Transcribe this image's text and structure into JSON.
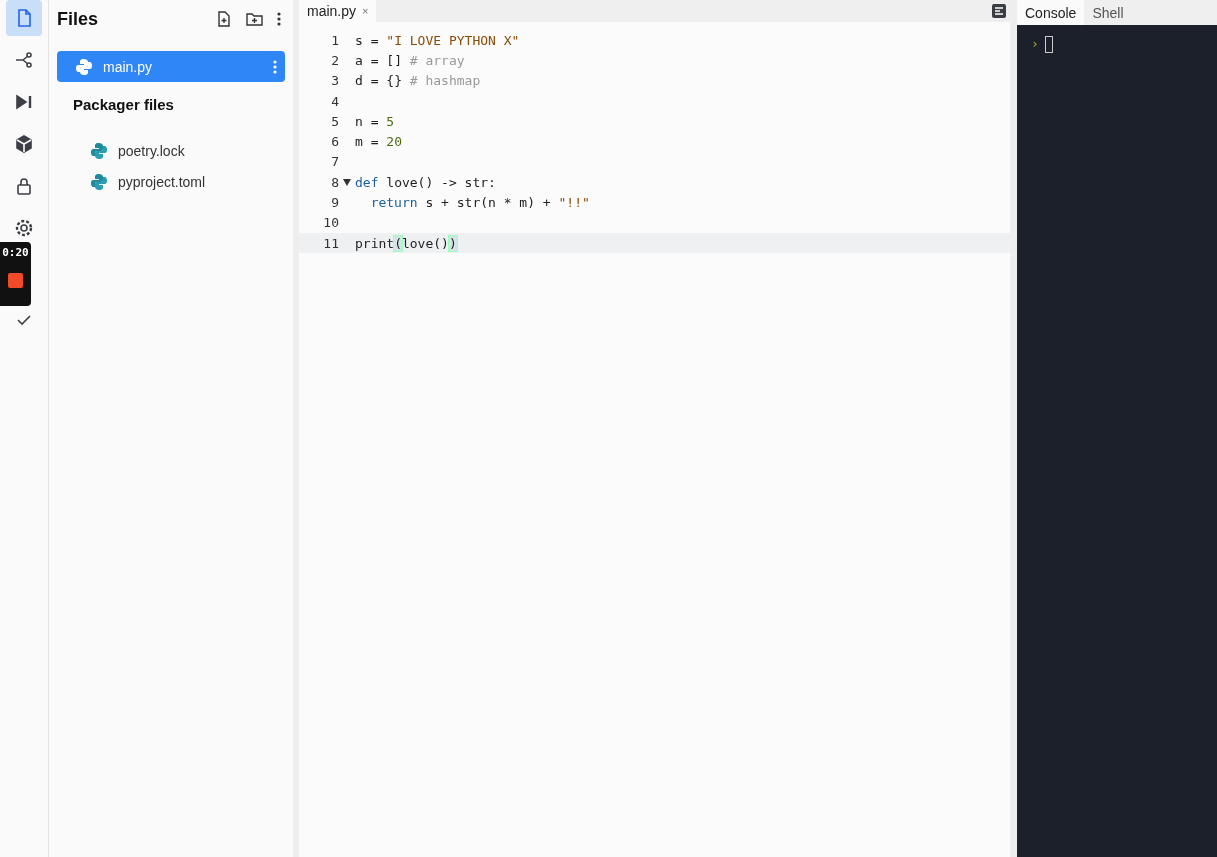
{
  "activity_bar": [
    {
      "selected": true
    },
    {
      "selected": false
    },
    {
      "selected": false
    },
    {
      "selected": false
    },
    {
      "selected": false
    },
    {
      "selected": false
    },
    {
      "selected": false
    }
  ],
  "recorder": {
    "time": "0:20"
  },
  "files": {
    "title": "Files",
    "items": [
      {
        "name": "main.py",
        "selected": true
      }
    ],
    "packager_title": "Packager files",
    "packager_items": [
      {
        "name": "poetry.lock"
      },
      {
        "name": "pyproject.toml"
      }
    ]
  },
  "editor": {
    "tabs": [
      {
        "label": "main.py",
        "close": "×",
        "selected": true
      }
    ],
    "lines": [
      {
        "number": "1",
        "fold": false,
        "current": false,
        "tokens": [
          {
            "t": "s = ",
            "kind": "plain"
          },
          {
            "t": "\"I LOVE PYTHON X\"",
            "kind": "str"
          }
        ]
      },
      {
        "number": "2",
        "fold": false,
        "current": false,
        "tokens": [
          {
            "t": "a = [] ",
            "kind": "plain"
          },
          {
            "t": "# array",
            "kind": "comment"
          }
        ]
      },
      {
        "number": "3",
        "fold": false,
        "current": false,
        "tokens": [
          {
            "t": "d = {} ",
            "kind": "plain"
          },
          {
            "t": "# hashmap",
            "kind": "comment"
          }
        ]
      },
      {
        "number": "4",
        "fold": false,
        "current": false
      },
      {
        "number": "5",
        "fold": false,
        "current": false,
        "tokens": [
          {
            "t": "n = ",
            "kind": "plain"
          },
          {
            "t": "5",
            "kind": "num"
          }
        ]
      },
      {
        "number": "6",
        "fold": false,
        "current": false,
        "tokens": [
          {
            "t": "m = ",
            "kind": "plain"
          },
          {
            "t": "20",
            "kind": "num"
          }
        ]
      },
      {
        "number": "7",
        "fold": false,
        "current": false
      },
      {
        "number": "8",
        "fold": true,
        "current": false,
        "tokens": [
          {
            "t": "def",
            "kind": "kw"
          },
          {
            "t": " love() -> str:",
            "kind": "plain"
          }
        ]
      },
      {
        "number": "9",
        "fold": false,
        "current": false,
        "indented": true,
        "tokens": [
          {
            "t": "return",
            "kind": "kw"
          },
          {
            "t": " s + str(n * m) + ",
            "kind": "plain"
          },
          {
            "t": "\"!!\"",
            "kind": "str"
          }
        ]
      },
      {
        "number": "10",
        "fold": false,
        "current": false
      },
      {
        "number": "11",
        "fold": false,
        "current": true,
        "tokens": [
          {
            "t": "print",
            "kind": "plain"
          },
          {
            "t": "(",
            "kind": "match"
          },
          {
            "t": "love()",
            "kind": "plain"
          },
          {
            "t": ")",
            "kind": "match"
          }
        ]
      }
    ]
  },
  "console": {
    "tabs": [
      {
        "label": "Console",
        "selected": true
      },
      {
        "label": "Shell",
        "selected": false
      }
    ],
    "prompt": "›"
  }
}
